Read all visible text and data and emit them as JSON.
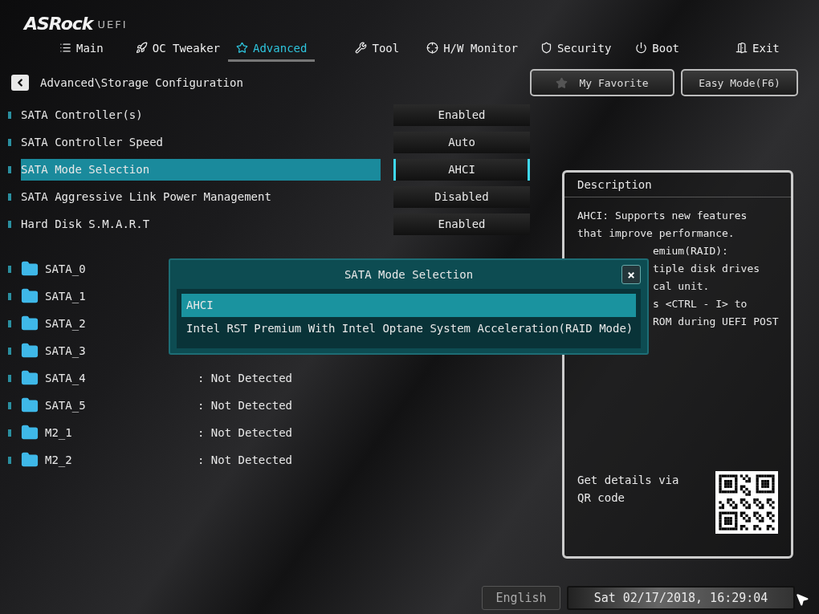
{
  "logo": {
    "brand": "ASRock",
    "suffix": "UEFI"
  },
  "tabs": [
    {
      "label": "Main",
      "selected": false
    },
    {
      "label": "OC Tweaker",
      "selected": false
    },
    {
      "label": "Advanced",
      "selected": true
    },
    {
      "label": "Tool",
      "selected": false
    },
    {
      "label": "H/W Monitor",
      "selected": false
    },
    {
      "label": "Security",
      "selected": false
    },
    {
      "label": "Boot",
      "selected": false
    },
    {
      "label": "Exit",
      "selected": false
    }
  ],
  "breadcrumb": "Advanced\\Storage Configuration",
  "top_buttons": [
    {
      "label": "My Favorite"
    },
    {
      "label": "Easy Mode(F6)"
    }
  ],
  "settings": [
    {
      "label": "SATA Controller(s)",
      "value": "Enabled",
      "selected": false
    },
    {
      "label": "SATA Controller Speed",
      "value": "Auto",
      "selected": false
    },
    {
      "label": "SATA Mode Selection",
      "value": "AHCI",
      "selected": true
    },
    {
      "label": "SATA Aggressive Link Power Management",
      "value": "Disabled",
      "selected": false
    },
    {
      "label": "Hard Disk S.M.A.R.T",
      "value": "Enabled",
      "selected": false
    }
  ],
  "drives": [
    {
      "name": "SATA_0"
    },
    {
      "name": "SATA_1"
    },
    {
      "name": "SATA_2"
    },
    {
      "name": "SATA_3"
    },
    {
      "name": "SATA_4",
      "value": ": Not Detected"
    },
    {
      "name": "SATA_5",
      "value": ": Not Detected"
    },
    {
      "name": "M2_1",
      "value": ": Not Detected"
    },
    {
      "name": "M2_2",
      "value": ": Not Detected"
    }
  ],
  "description": {
    "title": "Description",
    "lines": [
      {
        "text": "AHCI: Supports new features",
        "kind": "full"
      },
      {
        "text": "that improve performance.",
        "kind": "full"
      },
      {
        "text": "emium(RAID):",
        "kind": "partial"
      },
      {
        "text": "tiple disk drives",
        "kind": "partial"
      },
      {
        "text": "cal unit.",
        "kind": "partial"
      },
      {
        "text": "s <CTRL - I> to",
        "kind": "partial"
      },
      {
        "text": "ROM during UEFI POST",
        "kind": "partial"
      }
    ],
    "qr_text": "Get details via QR code"
  },
  "popup": {
    "title": "SATA Mode Selection",
    "close": "×",
    "options": [
      {
        "label": "AHCI",
        "selected": true
      },
      {
        "label": "Intel RST Premium With Intel Optane System Acceleration(RAID Mode)",
        "selected": false
      }
    ]
  },
  "status_bar": {
    "language": "English",
    "datetime": "Sat 02/17/2018, 16:29:04"
  }
}
